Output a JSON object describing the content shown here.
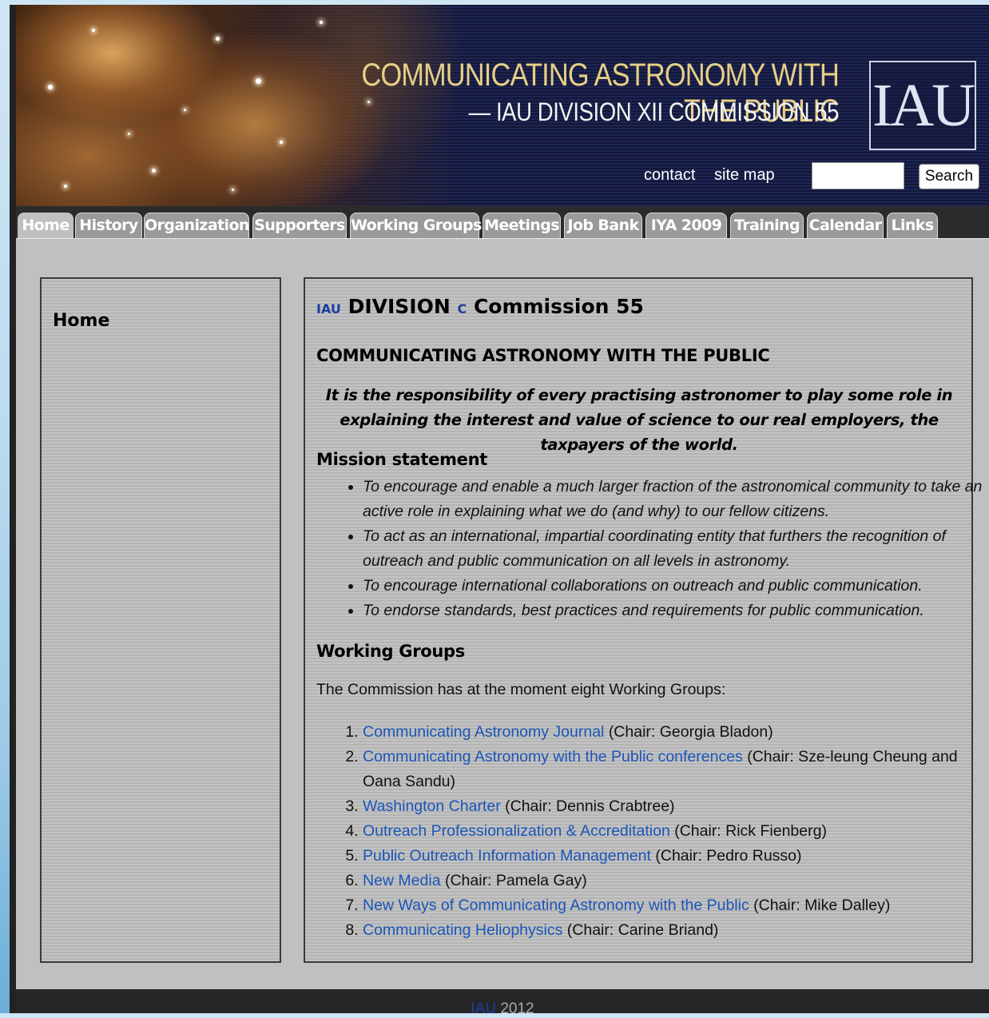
{
  "header": {
    "title_line1": "COMMUNICATING ASTRONOMY WITH THE PUBLIC",
    "title_line2": "— IAU DIVISION XII COMMISSION 55",
    "logo_text": "IAU",
    "contact_link": "contact",
    "sitemap_link": "site map",
    "search_value": "",
    "search_button": "Search"
  },
  "tabs": [
    {
      "label": "Home",
      "active": true
    },
    {
      "label": "History"
    },
    {
      "label": "Organization"
    },
    {
      "label": "Supporters"
    },
    {
      "label": "Working Groups"
    },
    {
      "label": "Meetings"
    },
    {
      "label": "Job Bank"
    },
    {
      "label": "IYA 2009"
    },
    {
      "label": "Training"
    },
    {
      "label": "Calendar"
    },
    {
      "label": "Links"
    }
  ],
  "sidebar": {
    "title": "Home"
  },
  "main": {
    "heading_iau": "IAU",
    "heading_division": "DIVISION",
    "heading_c": "C",
    "heading_commission": "Commission 55",
    "subheading": "COMMUNICATING ASTRONOMY WITH THE PUBLIC",
    "quote": "It is the responsibility of every practising astronomer to play some role in explaining the interest and value of science to our real employers, the taxpayers of the world.",
    "mission_title": "Mission statement",
    "mission_items": [
      "To encourage and enable a much larger fraction of the astronomical community to take an active role in explaining what we do (and why) to our fellow citizens.",
      "To act as an international, impartial coordinating entity that furthers the recognition of outreach and public communication on all levels in astronomy.",
      "To encourage international collaborations on outreach and public communication.",
      "To endorse standards, best practices and requirements for public communication."
    ],
    "wg_title": "Working Groups",
    "wg_intro": "The Commission has at the moment eight Working Groups:",
    "working_groups": [
      {
        "name": "Communicating Astronomy Journal",
        "chair": "(Chair: Georgia Bladon)"
      },
      {
        "name": "Communicating Astronomy with the Public conferences",
        "chair": "(Chair: Sze-leung Cheung and Oana Sandu)"
      },
      {
        "name": "Washington Charter",
        "chair": "(Chair: Dennis Crabtree)"
      },
      {
        "name": "Outreach Professionalization & Accreditation",
        "chair": "(Chair: Rick Fienberg)"
      },
      {
        "name": "Public Outreach Information Management",
        "chair": "(Chair: Pedro Russo)"
      },
      {
        "name": "New Media",
        "chair": "(Chair: Pamela Gay)"
      },
      {
        "name": "New Ways of Communicating Astronomy with the Public",
        "chair": "(Chair: Mike Dalley)"
      },
      {
        "name": "Communicating Heliophysics",
        "chair": "(Chair: Carine Briand)"
      }
    ]
  },
  "footer": {
    "iau": "IAU",
    "year": "2012"
  },
  "colors": {
    "link": "#1b56b8",
    "iau_blue": "#1b3fa0",
    "header_gold": "#e6cf86"
  }
}
